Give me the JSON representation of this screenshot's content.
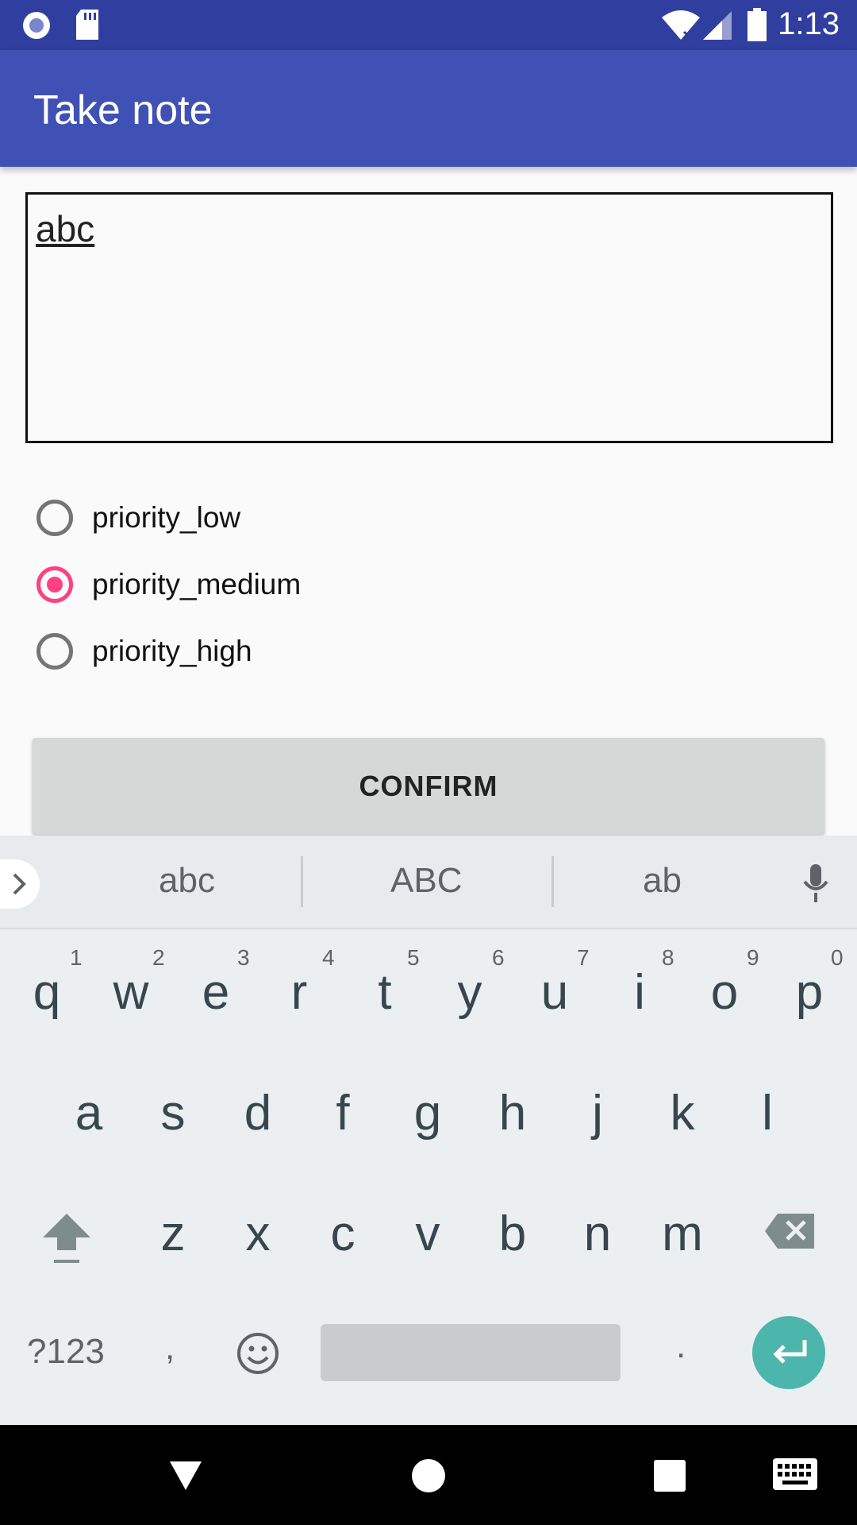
{
  "status_bar": {
    "time": "1:13"
  },
  "app_bar": {
    "title": "Take note"
  },
  "note": {
    "value": "abc"
  },
  "priority_options": [
    {
      "label": "priority_low",
      "checked": false
    },
    {
      "label": "priority_medium",
      "checked": true
    },
    {
      "label": "priority_high",
      "checked": false
    }
  ],
  "confirm": {
    "label": "CONFIRM"
  },
  "keyboard": {
    "suggestions": [
      "abc",
      "ABC",
      "ab"
    ],
    "row1": [
      "q",
      "w",
      "e",
      "r",
      "t",
      "y",
      "u",
      "i",
      "o",
      "p"
    ],
    "row1_hints": [
      "1",
      "2",
      "3",
      "4",
      "5",
      "6",
      "7",
      "8",
      "9",
      "0"
    ],
    "row2": [
      "a",
      "s",
      "d",
      "f",
      "g",
      "h",
      "j",
      "k",
      "l"
    ],
    "row3": [
      "z",
      "x",
      "c",
      "v",
      "b",
      "n",
      "m"
    ],
    "symbols_label": "?123",
    "comma": ",",
    "period": "."
  },
  "colors": {
    "primary": "#3f51b5",
    "primary_dark": "#303f9f",
    "accent": "#ff4081",
    "enter_key": "#4db6ac"
  }
}
